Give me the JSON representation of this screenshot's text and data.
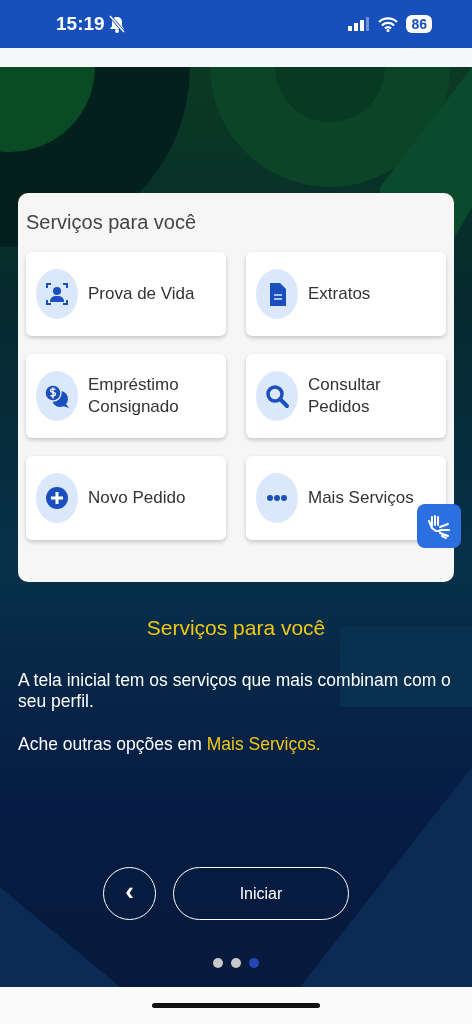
{
  "status_bar": {
    "time": "15:19",
    "battery": "86"
  },
  "card": {
    "title": "Serviços para você",
    "tiles": [
      {
        "label": "Prova de Vida",
        "kind": "face-scan"
      },
      {
        "label": "Extratos",
        "kind": "document"
      },
      {
        "label": "Empréstimo Consignado",
        "kind": "money-chat"
      },
      {
        "label": "Consultar Pedidos",
        "kind": "search"
      },
      {
        "label": "Novo Pedido",
        "kind": "plus"
      },
      {
        "label": "Mais Serviços",
        "kind": "more"
      }
    ]
  },
  "heading": "Serviços para você",
  "paragraphs": [
    "A tela inicial tem os serviços que mais combinam com o seu perfil."
  ],
  "hint": {
    "text": "Ache outras opções em ",
    "link": "Mais Serviços."
  },
  "buttons": {
    "back": "‹",
    "start": "Iniciar"
  },
  "pager": [
    {
      "selected": false
    },
    {
      "selected": false
    },
    {
      "selected": true
    }
  ]
}
